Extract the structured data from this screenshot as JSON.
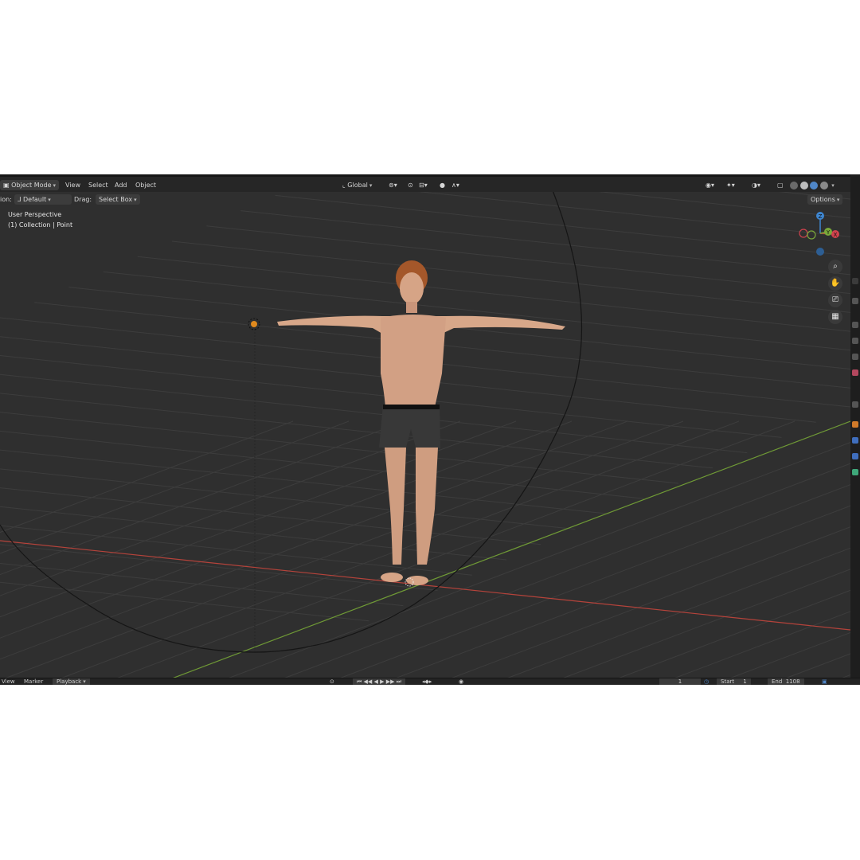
{
  "header": {
    "mode_label": "Object Mode",
    "menu": [
      "View",
      "Select",
      "Add",
      "Object"
    ],
    "transform_orientation": "Global"
  },
  "tool_settings": {
    "orientation_prefix": "ion:",
    "orientation_value": "Default",
    "drag_label": "Drag:",
    "drag_value": "Select Box",
    "options_label": "Options"
  },
  "overlay": {
    "view_name": "User Perspective",
    "collection": "(1) Collection | Point"
  },
  "gizmo": {
    "z": "Z",
    "y": "Y",
    "x": "X"
  },
  "timeline": {
    "view": "View",
    "marker": "Marker",
    "playback": "Playback",
    "current_frame": "1",
    "start_label": "Start",
    "start_value": "1",
    "end_label": "End",
    "end_value": "1108"
  },
  "icons": {
    "zoom": "search-icon",
    "pan": "hand-icon",
    "camera": "camera-icon",
    "ortho": "grid-icon"
  },
  "colors": {
    "x_axis": "#c0463f",
    "y_axis": "#7aa83a",
    "z_axis": "#3e86d0",
    "background": "#2f2f2f",
    "header": "#262626"
  }
}
